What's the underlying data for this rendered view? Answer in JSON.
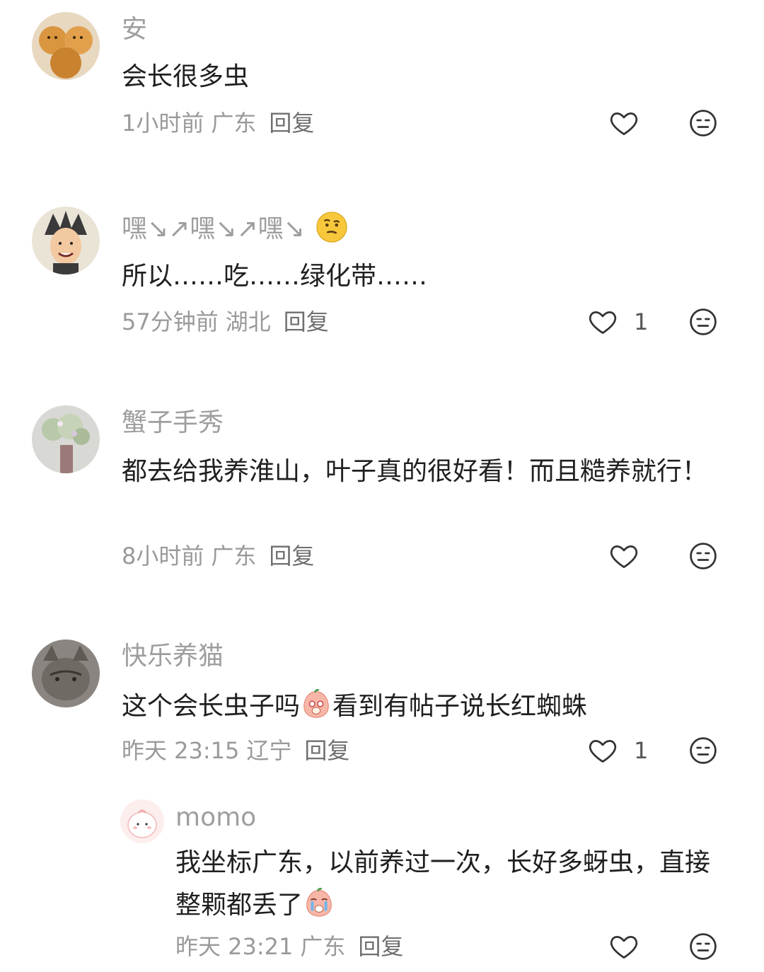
{
  "comments": [
    {
      "username": "安",
      "text": "会长很多虫",
      "time": "1小时前",
      "location": "广东",
      "reply_label": "回复",
      "likes": ""
    },
    {
      "username": "嘿↘↗嘿↘↗嘿↘",
      "text": "所以……吃……绿化带……",
      "time": "57分钟前",
      "location": "湖北",
      "reply_label": "回复",
      "likes": "1"
    },
    {
      "username": "蟹子手秀",
      "text": "都去给我养淮山，叶子真的很好看！而且糙养就行！",
      "time": "8小时前",
      "location": "广东",
      "reply_label": "回复",
      "likes": ""
    },
    {
      "username": "快乐养猫",
      "text_before": "这个会长虫子吗",
      "text_after": "看到有帖子说长红蜘蛛",
      "time": "昨天 23:15",
      "location": "辽宁",
      "reply_label": "回复",
      "likes": "1"
    }
  ],
  "reply": {
    "username": "momo",
    "text": "我坐标广东，以前养过一次，长好多蚜虫，直接整颗都丢了",
    "time": "昨天 23:21",
    "location": "广东",
    "reply_label": "回复",
    "likes": ""
  },
  "icons": {
    "like": "heart-outline-icon",
    "dislike": "meh-face-icon"
  },
  "colors": {
    "username": "#9e9e9e",
    "text": "#1f1f1f",
    "meta": "#9a9a9a",
    "icon": "#333333"
  }
}
